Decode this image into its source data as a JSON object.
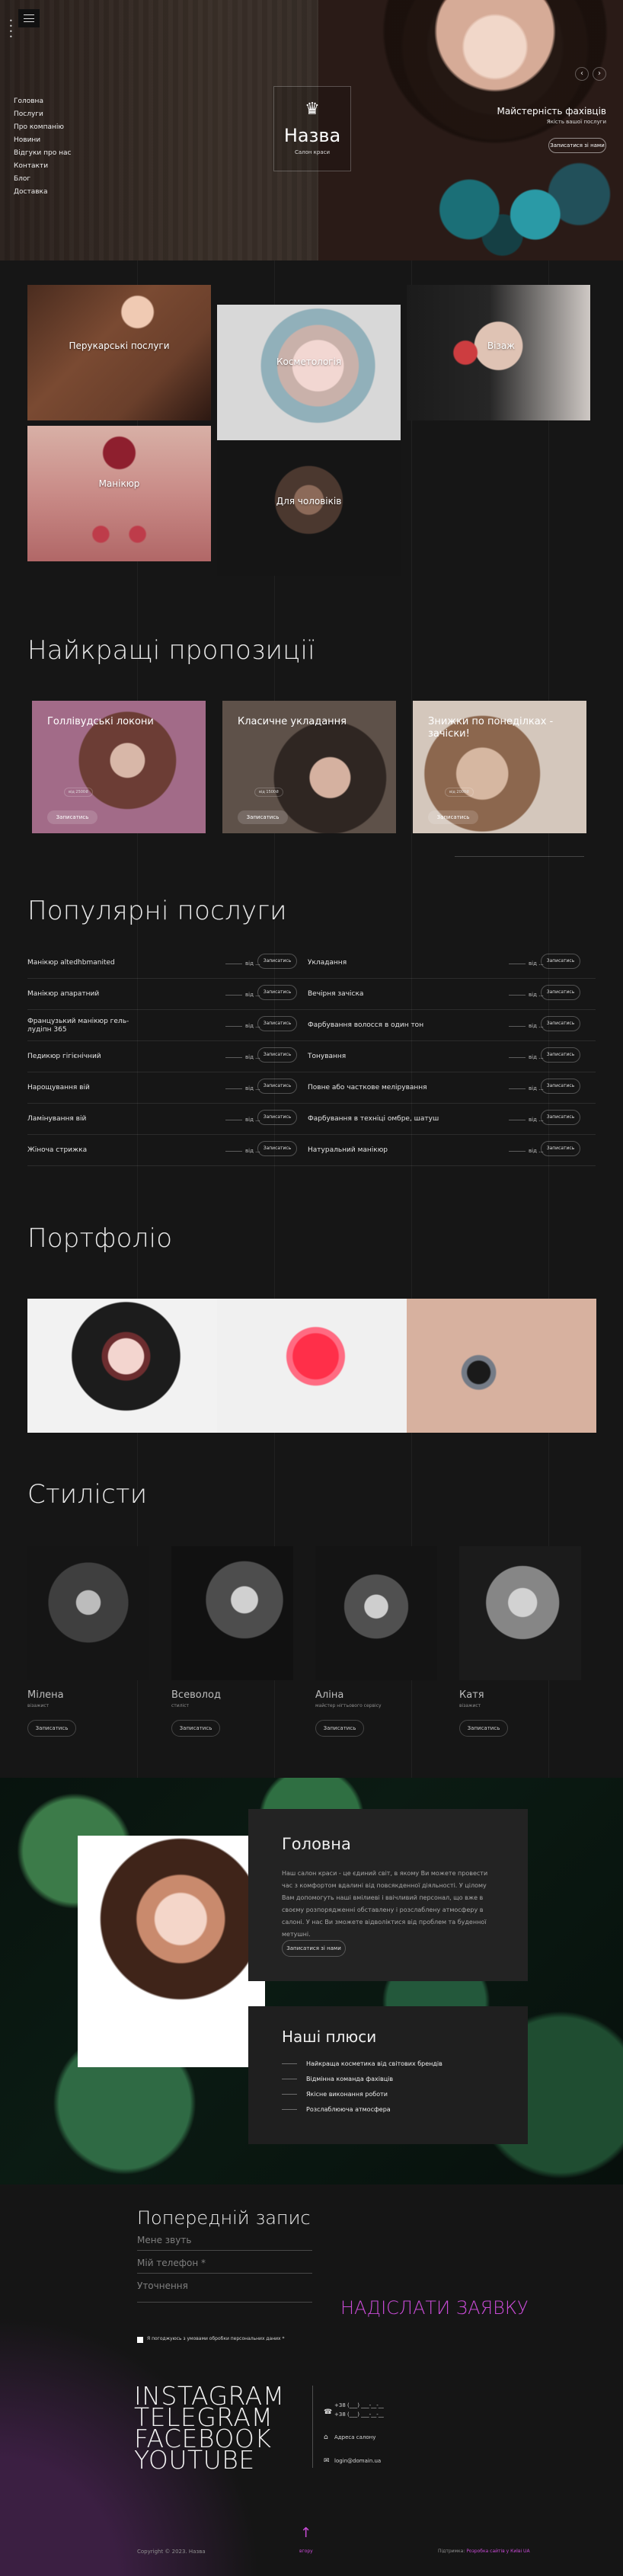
{
  "nav": [
    "Головна",
    "Послуги",
    "Про компанію",
    "Новини",
    "Відгуки про нас",
    "Контакти",
    "Блог",
    "Доставка"
  ],
  "brand": {
    "name": "Назва",
    "subtitle": "Салон краси"
  },
  "hero": {
    "title": "Майстерність фахівців",
    "subtitle": "Якість вашої послуги",
    "button": "Записатися зі нами"
  },
  "tiles": {
    "hair": "Перукарські послуги",
    "cosmetology": "Косметологія",
    "visage": "Візаж",
    "manicure": "Манікюр",
    "men": "Для чоловіків"
  },
  "sections": {
    "offers": "Найкращі пропозиції",
    "popular": "Популярні послуги",
    "portfolio": "Портфоліо",
    "stylists": "Стилісти"
  },
  "offers": [
    {
      "title": "Голлівудські локони",
      "badge": "від 2500₴",
      "button": "Записатись"
    },
    {
      "title": "Класичне укладання",
      "badge": "від 1500₴",
      "button": "Записатись"
    },
    {
      "title": "Знижки по понеділках - зачіски!",
      "badge": "від 2000₴",
      "button": "Записатись"
    }
  ],
  "services": [
    {
      "left": "Манікюр altedhbmanited",
      "price": "від ...",
      "right": "Укладання"
    },
    {
      "left": "Манікюр апаратний",
      "price": "від ...",
      "right": "Вечірня зачіска"
    },
    {
      "left": "Французький манікюр гель-лудіпн 365",
      "price": "від ...",
      "right": "Фарбування волосся в один тон"
    },
    {
      "left": "Педикюр гігієнічний",
      "price": "від ...",
      "right": "Тонування"
    },
    {
      "left": "Нарощування вій",
      "price": "від ...",
      "right": "Повне або часткове мелірування"
    },
    {
      "left": "Ламінування вій",
      "price": "від ...",
      "right": "Фарбування в техніці омбре, шатуш"
    },
    {
      "left": "Жіноча стрижка",
      "price": "від ...",
      "right": "Натуральний манікюр"
    }
  ],
  "service_button": "Записатись",
  "stylists": [
    {
      "name": "Мілена",
      "role": "візажист"
    },
    {
      "name": "Всеволод",
      "role": "стиліст"
    },
    {
      "name": "Аліна",
      "role": "майстер нігтьового сервісу"
    },
    {
      "name": "Катя",
      "role": "візажист"
    }
  ],
  "stylist_button": "Записатись",
  "about": {
    "title": "Головна",
    "text": "Наш салон краси - це єдиний світ, в якому Ви можете провести час з комфортом вдалині від повсякденної діяльності. У цілому Вам допомогуть наші вмілиеві і ввічливий персонал, що вже в своєму розпорядженні обставлену і розслаблену атмосферу в салоні. У нас Ви зможете відволіктися від проблем та буденної метушні.",
    "button": "Записатися зі нами"
  },
  "advantages": {
    "title": "Наші плюси",
    "items": [
      "Найкраща косметика від світових брендів",
      "Відмінна команда фахівців",
      "Якісне виконання роботи",
      "Розслаблююча атмосфера"
    ]
  },
  "form": {
    "title": "Попередній запис",
    "fields": [
      "Мене звуть",
      "Мій телефон *",
      "Уточнення"
    ],
    "consent": "Я погоджуюсь з умовами обробки персональних даних *",
    "submit": "НАДІСЛАТИ ЗАЯВКУ"
  },
  "social": [
    "INSTAGRAM",
    "TELEGRAM",
    "FACEBOOK",
    "YOUTUBE"
  ],
  "contacts": {
    "phone1": "+38 (___) ___-__-__",
    "phone2": "+38 (___) ___-__-__",
    "address": "Адреса салону",
    "email": "login@domain.ua"
  },
  "footer": {
    "copyright": "Copyright © 2023. Назва",
    "up": "вгору",
    "credits_prefix": "Підтримка:",
    "credits_link": "Розробка сайтів у Київі UA"
  },
  "colors": {
    "accent": "#c84bd6",
    "background": "#161616"
  }
}
